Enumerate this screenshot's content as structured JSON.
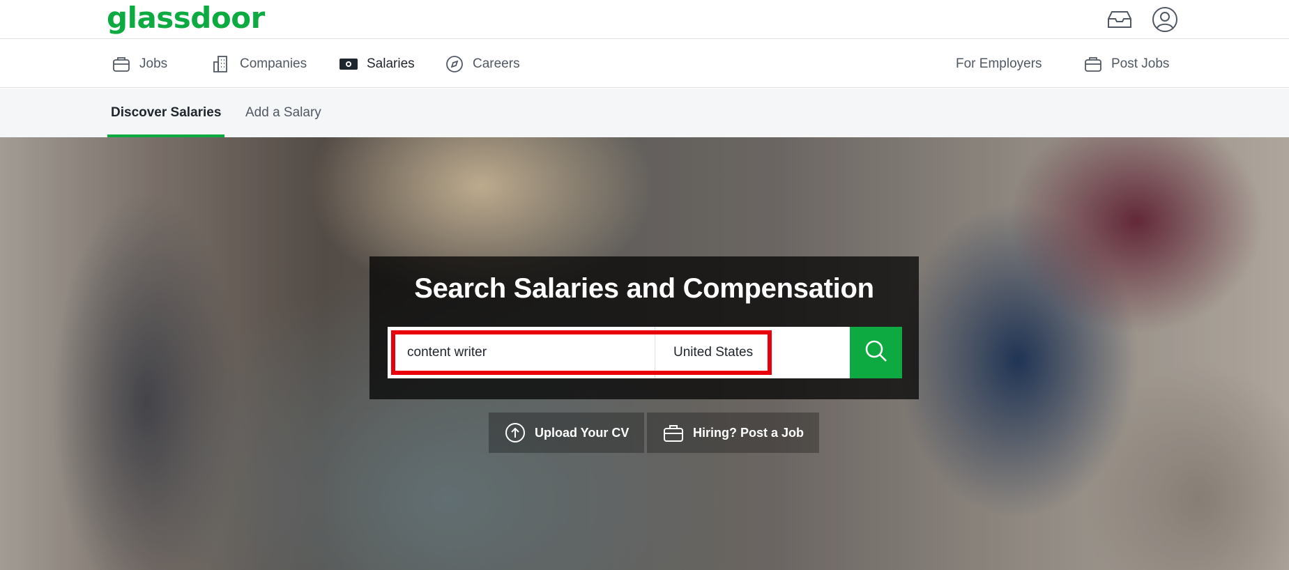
{
  "header": {
    "logo_text": "glassdoor",
    "brand_color": "#0caa41",
    "icons": [
      "inbox-icon",
      "account-icon"
    ]
  },
  "nav": {
    "items": [
      {
        "label": "Jobs",
        "icon": "briefcase-icon"
      },
      {
        "label": "Companies",
        "icon": "building-icon"
      },
      {
        "label": "Salaries",
        "icon": "money-icon",
        "active": true
      },
      {
        "label": "Careers",
        "icon": "compass-icon"
      }
    ],
    "right": [
      {
        "label": "For Employers"
      },
      {
        "label": "Post Jobs",
        "icon": "briefcase-icon"
      }
    ]
  },
  "subnav": {
    "tabs": [
      {
        "label": "Discover Salaries",
        "active": true
      },
      {
        "label": "Add a Salary"
      }
    ]
  },
  "hero": {
    "title": "Search Salaries and Compensation",
    "search": {
      "job_value": "content writer",
      "location_value": "United States",
      "button_icon": "search-icon",
      "highlight_color": "#e8000b"
    },
    "actions": [
      {
        "label": "Upload Your CV",
        "icon": "upload-icon"
      },
      {
        "label": "Hiring? Post a Job",
        "icon": "briefcase-icon"
      }
    ]
  }
}
